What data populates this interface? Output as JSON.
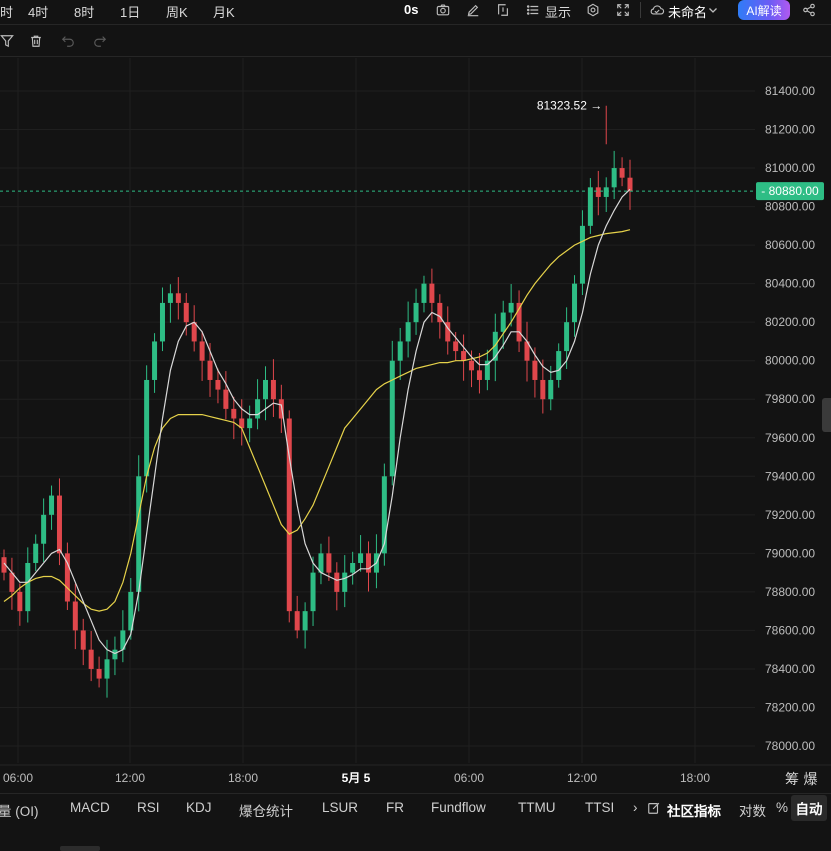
{
  "topbar": {
    "timeframes": [
      "时",
      "4时",
      "8时",
      "1日",
      "周K",
      "月K"
    ],
    "countdown": "0s",
    "display_label": "显示",
    "layout_name": "未命名",
    "ai_button": "AI解读"
  },
  "price_axis": {
    "labels": [
      "81400.00",
      "81200.00",
      "81000.00",
      "80800.00",
      "80600.00",
      "80400.00",
      "80200.00",
      "80000.00",
      "79800.00",
      "79600.00",
      "79400.00",
      "79200.00",
      "79000.00",
      "78800.00",
      "78600.00",
      "78400.00",
      "78200.00",
      "78000.00"
    ],
    "current_price": "80880.00",
    "high_marker": "81323.52 →"
  },
  "time_axis": {
    "labels": [
      "06:00",
      "12:00",
      "18:00",
      "5月 5",
      "06:00",
      "12:00",
      "18:00"
    ],
    "corner": "筹 爆"
  },
  "colors": {
    "background": "#131313",
    "up": "#2ebd85",
    "down": "#e0474c",
    "ma_fast": "#d8d8d8",
    "ma_slow": "#e6d24a",
    "price_tag": "#2ebd85"
  },
  "bottom_tabs": {
    "items": [
      "量 (OI)",
      "MACD",
      "RSI",
      "KDJ",
      "爆仓统计",
      "LSUR",
      "FR",
      "Fundflow",
      "TTMU",
      "TTSI"
    ],
    "more": "›",
    "community": "社区指标",
    "log": "对数",
    "percent": "%",
    "auto": "自动"
  },
  "chart_data": {
    "type": "candlestick",
    "x": [
      "06:00",
      "12:00",
      "18:00",
      "5月 5",
      "06:00",
      "12:00",
      "18:00"
    ],
    "ylim": [
      78000,
      81400
    ],
    "last_price": 80880.0,
    "high": 81323.52,
    "closes": [
      78900,
      78800,
      78700,
      78950,
      79050,
      79200,
      79300,
      79000,
      78750,
      78600,
      78500,
      78400,
      78350,
      78450,
      78500,
      78600,
      78800,
      79400,
      79900,
      80100,
      80300,
      80350,
      80300,
      80200,
      80100,
      80000,
      79900,
      79850,
      79750,
      79700,
      79650,
      79700,
      79800,
      79900,
      79800,
      79700,
      78700,
      78600,
      78700,
      78900,
      79000,
      78900,
      78800,
      78900,
      78950,
      79000,
      78900,
      79000,
      79400,
      80000,
      80100,
      80200,
      80300,
      80400,
      80300,
      80200,
      80100,
      80050,
      80000,
      79950,
      79900,
      80000,
      80150,
      80250,
      80300,
      80100,
      80000,
      79900,
      79800,
      79900,
      80050,
      80200,
      80400,
      80700,
      80900,
      80850,
      80900,
      81000,
      80950,
      80880
    ],
    "ma_fast": [
      78950,
      78900,
      78850,
      78850,
      78900,
      78950,
      79000,
      79020,
      78950,
      78850,
      78750,
      78650,
      78550,
      78500,
      78480,
      78500,
      78580,
      78800,
      79100,
      79400,
      79700,
      79950,
      80100,
      80180,
      80200,
      80150,
      80050,
      79950,
      79880,
      79800,
      79750,
      79720,
      79720,
      79750,
      79780,
      79770,
      79500,
      79250,
      79050,
      78950,
      78900,
      78880,
      78860,
      78870,
      78890,
      78920,
      78920,
      78950,
      79050,
      79300,
      79600,
      79850,
      80050,
      80200,
      80250,
      80230,
      80170,
      80120,
      80070,
      80020,
      79980,
      79980,
      80020,
      80080,
      80150,
      80150,
      80100,
      80030,
      79970,
      79940,
      79950,
      80000,
      80100,
      80250,
      80450,
      80600,
      80700,
      80780,
      80850,
      80890
    ],
    "ma_slow": [
      78750,
      78780,
      78820,
      78850,
      78870,
      78880,
      78880,
      78860,
      78820,
      78780,
      78740,
      78710,
      78700,
      78710,
      78750,
      78850,
      79000,
      79200,
      79400,
      79550,
      79650,
      79700,
      79720,
      79720,
      79720,
      79720,
      79710,
      79700,
      79690,
      79680,
      79650,
      79550,
      79450,
      79350,
      79250,
      79150,
      79100,
      79120,
      79180,
      79250,
      79350,
      79450,
      79550,
      79650,
      79700,
      79750,
      79800,
      79850,
      79880,
      79900,
      79920,
      79940,
      79960,
      79970,
      79980,
      79990,
      79990,
      80000,
      80000,
      80010,
      80020,
      80040,
      80080,
      80140,
      80200,
      80270,
      80340,
      80400,
      80450,
      80500,
      80540,
      80570,
      80600,
      80620,
      80640,
      80650,
      80660,
      80665,
      80670,
      80680
    ]
  }
}
